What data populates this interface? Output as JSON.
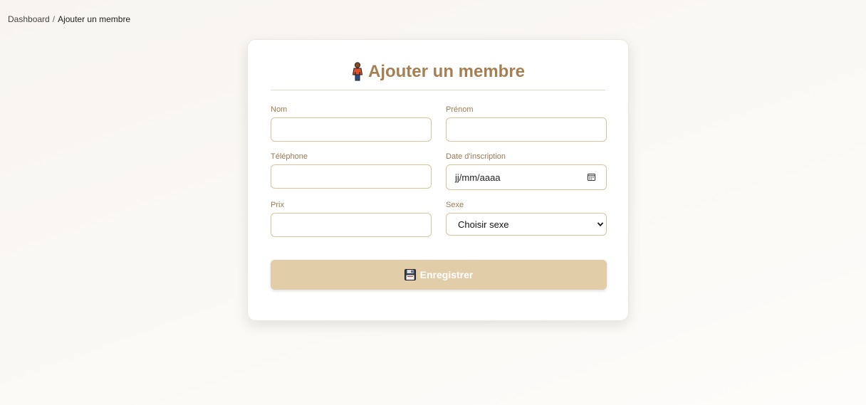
{
  "breadcrumb": {
    "home": "Dashboard",
    "separator": "/",
    "current": "Ajouter un membre"
  },
  "card": {
    "title": "Ajouter un membre",
    "title_icon": "person-standing-icon",
    "fields": {
      "nom": {
        "label": "Nom",
        "value": ""
      },
      "prenom": {
        "label": "Prénom",
        "value": ""
      },
      "telephone": {
        "label": "Téléphone",
        "value": ""
      },
      "date_inscription": {
        "label": "Date d'inscription",
        "placeholder": "jj/mm/aaaa",
        "icon": "calendar-icon"
      },
      "prix": {
        "label": "Prix",
        "value": ""
      },
      "sexe": {
        "label": "Sexe",
        "selected": "Choisir sexe",
        "icon": "chevron-down-icon"
      }
    },
    "submit": {
      "label": "Enregistrer",
      "icon": "floppy-disk-icon"
    }
  },
  "colors": {
    "accent": "#a57f52",
    "label": "#9a7a52",
    "border": "#d9c39f",
    "button_bg": "#e2cda9"
  }
}
